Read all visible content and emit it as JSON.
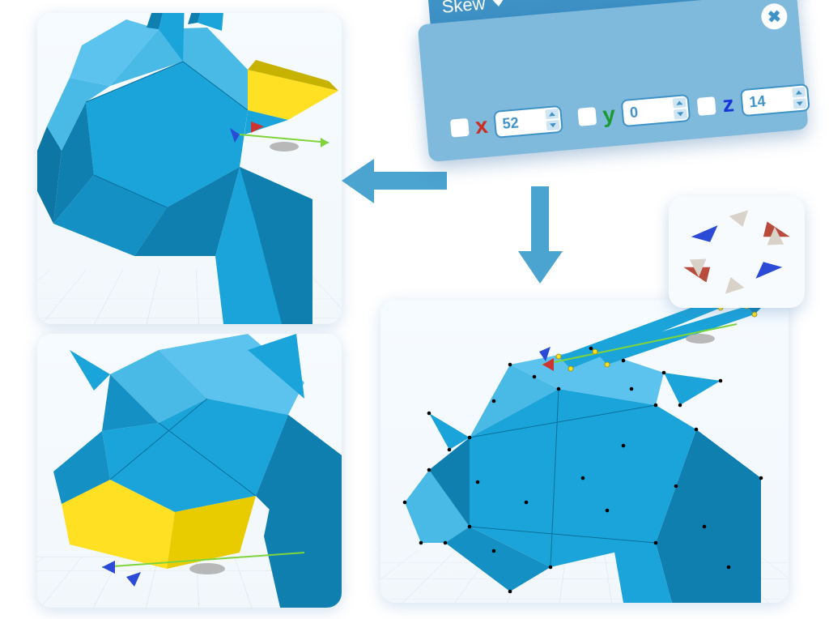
{
  "skew_panel": {
    "title": "Skew",
    "axes": {
      "x": {
        "label": "x",
        "value": "52",
        "checked": false
      },
      "y": {
        "label": "y",
        "value": "0",
        "checked": false
      },
      "z": {
        "label": "z",
        "value": "14",
        "checked": false
      }
    }
  },
  "colors": {
    "model": "#1aa4da",
    "model_dk": "#0f7fb0",
    "model_lt": "#5bc3ed",
    "highlight": "#ffe022",
    "panel_bg": "#7fb9dc",
    "header_bg": "#3e92c6",
    "arrow": "#4ba3cf"
  },
  "viewports": {
    "top_left": {
      "subject": "giraffe-head-side",
      "selection": "ear-face"
    },
    "bottom_left": {
      "subject": "giraffe-head-front",
      "selection": "snout-underside"
    },
    "bottom_right": {
      "subject": "giraffe-head-skewed",
      "show_vertices": true
    }
  },
  "gizmo": {
    "type": "skew-arrows"
  }
}
